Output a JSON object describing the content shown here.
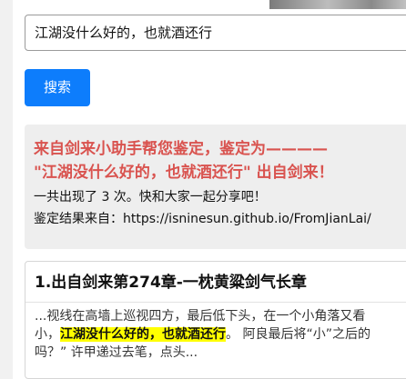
{
  "search": {
    "query": "江湖没什么好的，也就酒还行",
    "button_label": "搜索"
  },
  "result": {
    "verdict_line1": "来自剑来小助手帮您鉴定，鉴定为————",
    "verdict_line2": "\"江湖没什么好的，也就酒还行\" 出自剑来！",
    "count_text": "一共出现了 3 次。快和大家一起分享吧！",
    "source_text": "鉴定结果来自：https://isninesun.github.io/FromJianLai/"
  },
  "chapter": {
    "title": "1.出自剑来第274章-一枕黄粱剑气长章",
    "snippet_line1": "...视线在高墙上巡视四方，最后低下头，在一个小角落又看",
    "snippet_line2_before": "小，",
    "snippet_line2_highlight": "江湖没什么好的，也就酒还行",
    "snippet_line2_after": "。 阿良最后将“小”之后的",
    "snippet_line3": "吗？” 许甲递过去笔，点头..."
  },
  "colors": {
    "accent": "#0d7dfc",
    "verdict": "#d9534f",
    "highlight": "#ffff00"
  }
}
